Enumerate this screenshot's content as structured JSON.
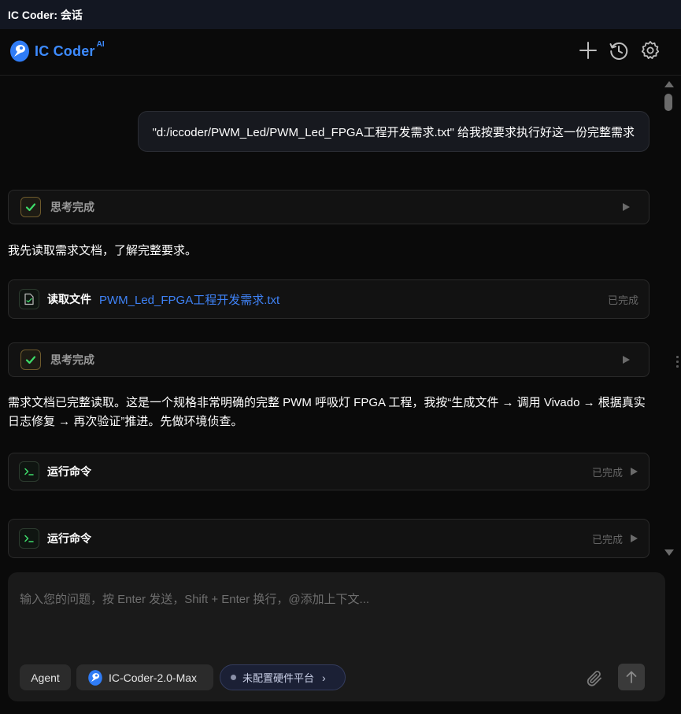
{
  "window": {
    "title": "IC Coder: 会话"
  },
  "header": {
    "logo_text": "IC Coder",
    "logo_sup": "AI",
    "icons": [
      "plus-icon",
      "history-icon",
      "gear-icon"
    ]
  },
  "chat": {
    "user_message": "\"d:/iccoder/PWM_Led/PWM_Led_FPGA工程开发需求.txt\" 给我按要求执行好这一份完整需求",
    "thinking_1": {
      "label": "思考完成"
    },
    "message_1": "我先读取需求文档，了解完整要求。",
    "read_file": {
      "label": "读取文件",
      "file": "PWM_Led_FPGA工程开发需求.txt",
      "status": "已完成"
    },
    "thinking_2": {
      "label": "思考完成"
    },
    "message_2": "需求文档已完整读取。这是一个规格非常明确的完整 PWM 呼吸灯 FPGA 工程，我按“生成文件 → 调用 Vivado → 根据真实日志修复 → 再次验证”推进。先做环境侦查。",
    "commands": [
      {
        "label": "运行命令",
        "status": "已完成"
      },
      {
        "label": "运行命令",
        "status": "已完成"
      }
    ]
  },
  "input": {
    "placeholder": "输入您的问题，按 Enter 发送，Shift + Enter 换行，@添加上下文...",
    "mode": "Agent",
    "model": "IC-Coder-2.0-Max",
    "platform": "未配置硬件平台"
  },
  "colors": {
    "accent": "#3d8bff",
    "link": "#3f83f8",
    "success": "#3ddc6a",
    "background": "#0a0a0a",
    "panel": "#1a1a1a"
  }
}
